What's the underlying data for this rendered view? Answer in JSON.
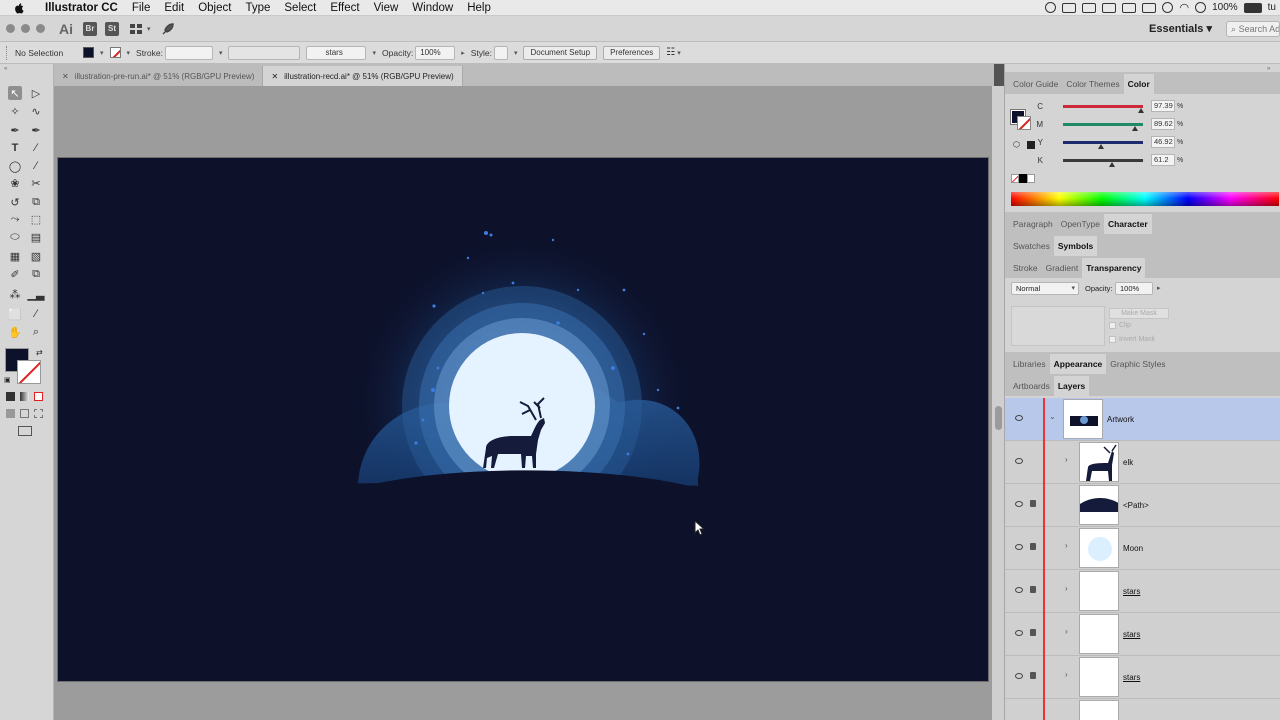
{
  "menubar": {
    "app": "Illustrator CC",
    "items": [
      "File",
      "Edit",
      "Object",
      "Type",
      "Select",
      "Effect",
      "View",
      "Window",
      "Help"
    ],
    "battery": "100%",
    "user_initial": "tu"
  },
  "appbar": {
    "app_abbr": "Ai",
    "bridge": "Br",
    "stock": "St",
    "workspace": "Essentials",
    "search_placeholder": "Search Ad"
  },
  "controlbar": {
    "selection": "No Selection",
    "stroke_label": "Stroke:",
    "brush_value": "stars",
    "opacity_label": "Opacity:",
    "opacity_value": "100%",
    "style_label": "Style:",
    "doc_setup": "Document Setup",
    "preferences": "Preferences"
  },
  "tabs": [
    {
      "label": "illustration-pre-run.ai* @ 51% (RGB/GPU Preview)",
      "active": false
    },
    {
      "label": "illustration-recd.ai* @ 51% (RGB/GPU Preview)",
      "active": true
    }
  ],
  "color_panel": {
    "tabs": [
      "Color Guide",
      "Color Themes",
      "Color"
    ],
    "channels": [
      {
        "label": "C",
        "value": "97.39",
        "fraction": 0.974,
        "color": "#cc2a3a"
      },
      {
        "label": "M",
        "value": "89.62",
        "fraction": 0.896,
        "color": "#1f8a64"
      },
      {
        "label": "Y",
        "value": "46.92",
        "fraction": 0.469,
        "color": "#1c2a6e"
      },
      {
        "label": "K",
        "value": "61.2",
        "fraction": 0.612,
        "color": "#3a3a3a"
      }
    ],
    "percent_sign": "%"
  },
  "char_panel": {
    "tabs": [
      "Paragraph",
      "OpenType",
      "Character"
    ]
  },
  "swatch_panel": {
    "tabs": [
      "Swatches",
      "Symbols"
    ]
  },
  "transparency_panel": {
    "tabs": [
      "Stroke",
      "Gradient",
      "Transparency"
    ],
    "blend_mode": "Normal",
    "opacity_label": "Opacity:",
    "opacity_value": "100%",
    "make_mask": "Make Mask",
    "clip": "Clip",
    "invert_mask": "Invert Mask"
  },
  "appearance_panel": {
    "tabs": [
      "Libraries",
      "Appearance",
      "Graphic Styles"
    ]
  },
  "layers_panel": {
    "tabs": [
      "Artboards",
      "Layers"
    ],
    "rows": [
      {
        "name": "Artwork",
        "type": "layer"
      },
      {
        "name": "elk",
        "type": "group"
      },
      {
        "name": "<Path>",
        "type": "path"
      },
      {
        "name": "Moon",
        "type": "group"
      },
      {
        "name": "stars",
        "type": "group"
      },
      {
        "name": "stars",
        "type": "group"
      },
      {
        "name": "stars",
        "type": "group"
      }
    ]
  },
  "colors": {
    "artboard": "#0d112a",
    "moon": "#e4f3ff",
    "glow": "#2f6fb5",
    "selection_row": "#b8c8ea"
  }
}
